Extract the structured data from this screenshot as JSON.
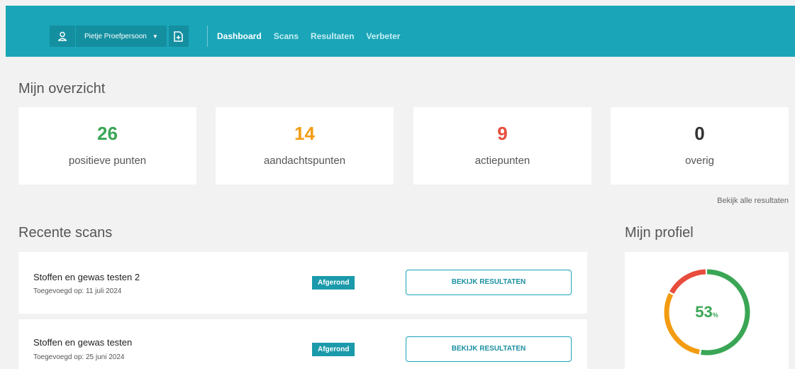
{
  "header": {
    "user_name": "Pietje Proefpersoon",
    "nav": [
      {
        "label": "Dashboard",
        "active": true
      },
      {
        "label": "Scans",
        "active": false
      },
      {
        "label": "Resultaten",
        "active": false
      },
      {
        "label": "Verbeter",
        "active": false
      }
    ]
  },
  "overview": {
    "title": "Mijn overzicht",
    "stats": [
      {
        "value": "26",
        "label": "positieve punten",
        "color": "#3aa655"
      },
      {
        "value": "14",
        "label": "aandachtspunten",
        "color": "#f39c12"
      },
      {
        "value": "9",
        "label": "actiepunten",
        "color": "#e74c3c"
      },
      {
        "value": "0",
        "label": "overig",
        "color": "#333333"
      }
    ],
    "all_results_link": "Bekijk alle resultaten"
  },
  "recent": {
    "title": "Recente scans",
    "scans": [
      {
        "title": "Stoffen en gewas testen 2",
        "date": "Toegevoegd op: 11 juli 2024",
        "status": "Afgerond",
        "button": "BEKIJK RESULTATEN"
      },
      {
        "title": "Stoffen en gewas testen",
        "date": "Toegevoegd op: 25 juni 2024",
        "status": "Afgerond",
        "button": "BEKIJK RESULTATEN"
      }
    ]
  },
  "profile": {
    "title": "Mijn profiel",
    "percentage": "53",
    "unit": "%",
    "donut": [
      {
        "fraction": 0.53,
        "color": "#3aa655"
      },
      {
        "fraction": 0.3,
        "color": "#f39c12"
      },
      {
        "fraction": 0.17,
        "color": "#e74c3c"
      }
    ]
  }
}
